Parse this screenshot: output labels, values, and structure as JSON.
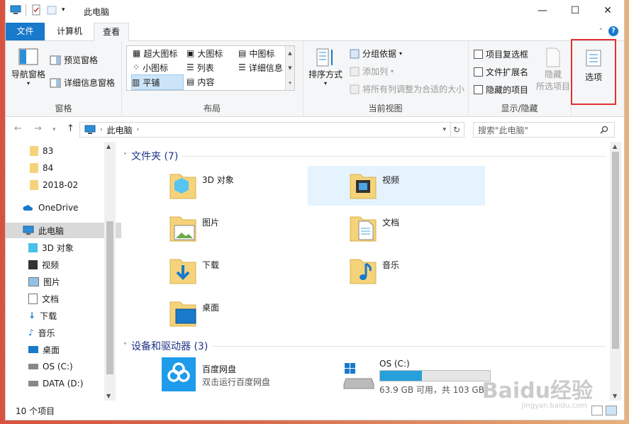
{
  "window": {
    "title": "此电脑"
  },
  "tabs": {
    "file": "文件",
    "computer": "计算机",
    "view": "查看"
  },
  "ribbon": {
    "panes": {
      "label": "窗格",
      "nav_pane": "导航窗格",
      "preview_pane": "预览窗格",
      "details_pane": "详细信息窗格"
    },
    "layout": {
      "label": "布局",
      "items": [
        "超大图标",
        "大图标",
        "中图标",
        "小图标",
        "列表",
        "详细信息",
        "平铺",
        "内容"
      ]
    },
    "current_view": {
      "label": "当前视图",
      "sort_by": "排序方式",
      "group_by": "分组依据",
      "add_columns": "添加列",
      "fit_columns": "将所有列调整为合适的大小"
    },
    "show_hide": {
      "label": "显示/隐藏",
      "item_checkboxes": "项目复选框",
      "file_extensions": "文件扩展名",
      "hidden_items": "隐藏的项目",
      "hide_selected": "隐藏",
      "hide_selected2": "所选项目"
    },
    "options": "选项"
  },
  "address": {
    "path": "此电脑",
    "search_placeholder": "搜索\"此电脑\""
  },
  "nav": {
    "items": [
      "83",
      "84",
      "2018-02",
      "OneDrive",
      "此电脑",
      "3D 对象",
      "视频",
      "图片",
      "文档",
      "下载",
      "音乐",
      "桌面",
      "OS (C:)",
      "DATA (D:)"
    ]
  },
  "content": {
    "folders_header": "文件夹 (7)",
    "folders": [
      "3D 对象",
      "视频",
      "图片",
      "文档",
      "下载",
      "音乐",
      "桌面"
    ],
    "devices_header": "设备和驱动器 (3)",
    "baidu": {
      "name": "百度网盘",
      "sub": "双击运行百度网盘"
    },
    "drive_c": {
      "name": "OS (C:)",
      "sub": "63.9 GB 可用，共 103 GB",
      "used_fraction": 0.38
    }
  },
  "status": {
    "count": "10 个项目"
  },
  "watermark": {
    "text": "Baidu经验",
    "sub": "jingyan.baidu.com"
  },
  "colors": {
    "accent": "#1979ca",
    "highlight": "#e23030",
    "folder": "#f5d37b"
  }
}
